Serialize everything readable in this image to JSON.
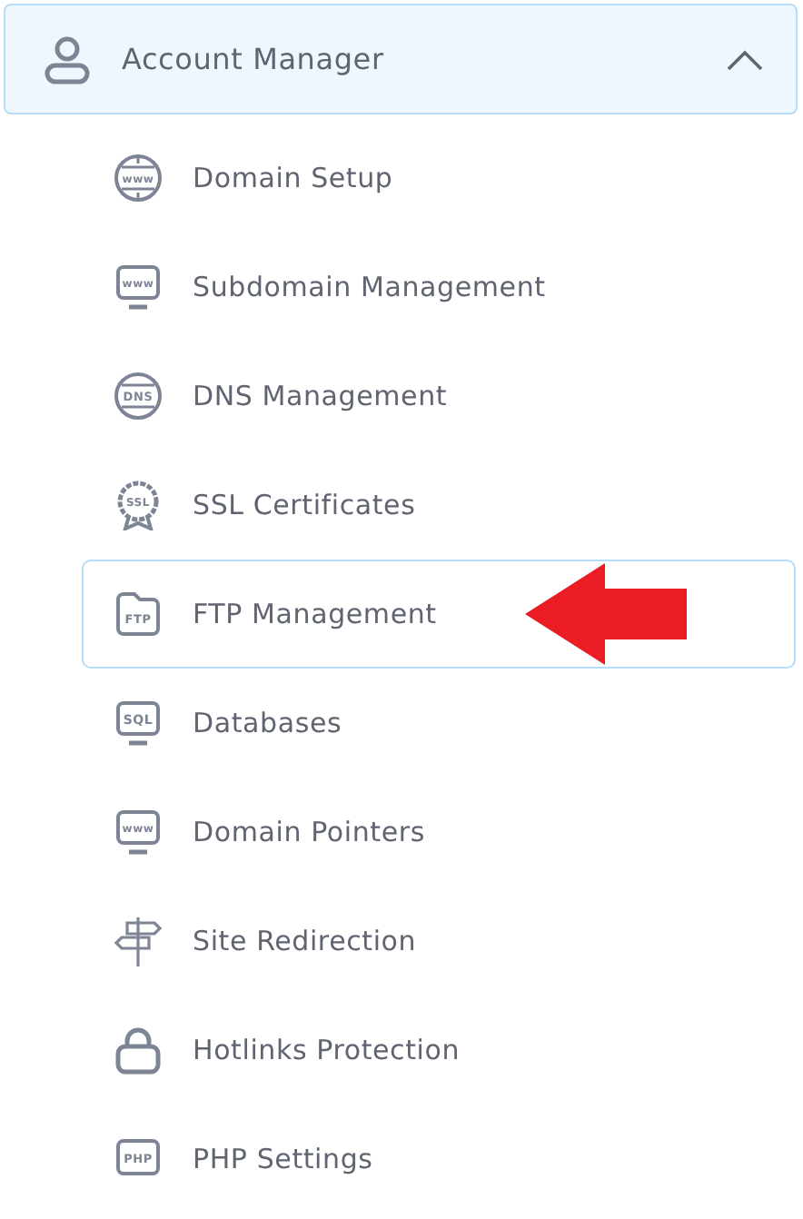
{
  "section": {
    "title": "Account Manager",
    "expanded": true
  },
  "items": [
    {
      "label": "Domain Setup",
      "icon_label": "www",
      "selected": false
    },
    {
      "label": "Subdomain Management",
      "icon_label": "www",
      "selected": false
    },
    {
      "label": "DNS Management",
      "icon_label": "DNS",
      "selected": false
    },
    {
      "label": "SSL Certificates",
      "icon_label": "SSL",
      "selected": false
    },
    {
      "label": "FTP Management",
      "icon_label": "FTP",
      "selected": true
    },
    {
      "label": "Databases",
      "icon_label": "SQL",
      "selected": false
    },
    {
      "label": "Domain Pointers",
      "icon_label": "www",
      "selected": false
    },
    {
      "label": "Site Redirection",
      "selected": false
    },
    {
      "label": "Hotlinks Protection",
      "selected": false
    },
    {
      "label": "PHP Settings",
      "icon_label": "PHP",
      "selected": false
    }
  ]
}
